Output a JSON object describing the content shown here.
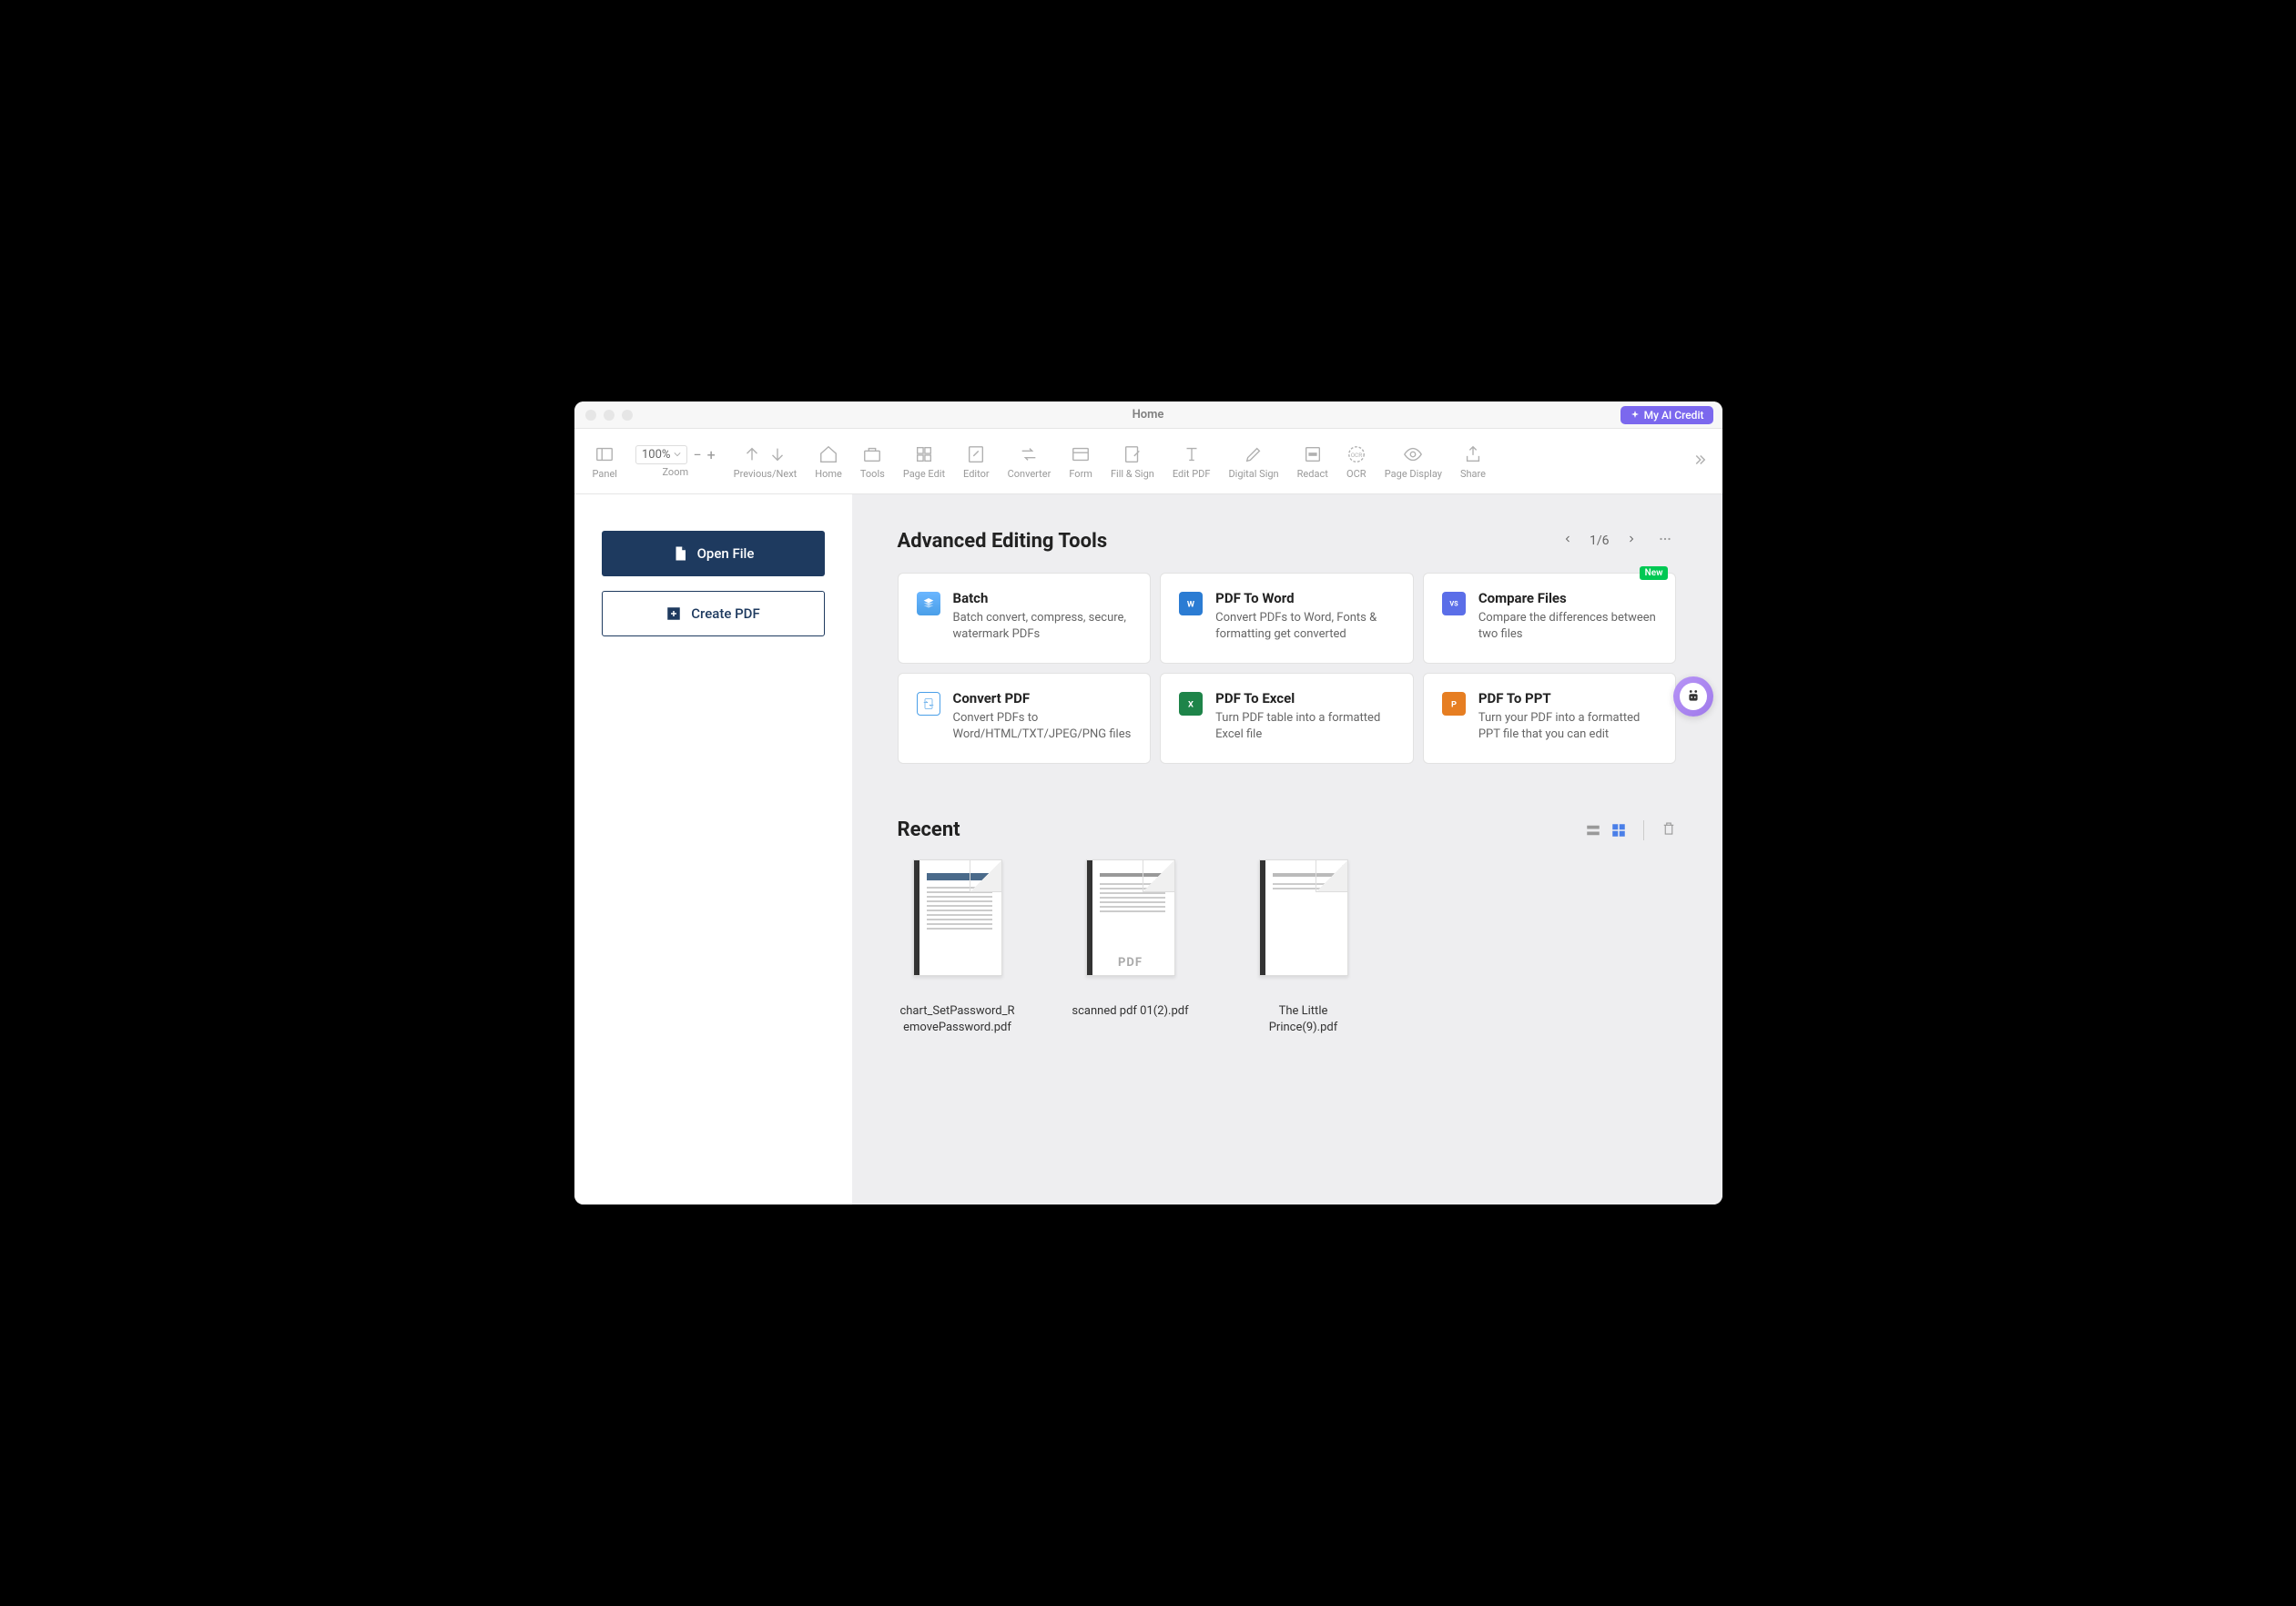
{
  "title": "Home",
  "credit_button": "My AI Credit",
  "toolbar": {
    "panel": "Panel",
    "zoom_label": "Zoom",
    "zoom_value": "100%",
    "items": [
      "Previous/Next",
      "Home",
      "Tools",
      "Page Edit",
      "Editor",
      "Converter",
      "Form",
      "Fill & Sign",
      "Edit PDF",
      "Digital Sign",
      "Redact",
      "OCR",
      "Page Display",
      "Share"
    ]
  },
  "sidebar": {
    "open": "Open File",
    "create": "Create PDF"
  },
  "tools": {
    "heading": "Advanced Editing Tools",
    "page": "1/6",
    "cards": [
      {
        "title": "Batch",
        "desc": "Batch convert, compress, secure, watermark PDFs",
        "icon": "batch",
        "new": false
      },
      {
        "title": "PDF To Word",
        "desc": "Convert PDFs to Word, Fonts & formatting get converted",
        "icon": "word",
        "new": false
      },
      {
        "title": "Compare Files",
        "desc": "Compare the differences between two files",
        "icon": "compare",
        "new": true
      },
      {
        "title": "Convert PDF",
        "desc": "Convert PDFs to Word/HTML/TXT/JPEG/PNG files",
        "icon": "convert",
        "new": false
      },
      {
        "title": "PDF To Excel",
        "desc": "Turn PDF table into a formatted Excel file",
        "icon": "excel",
        "new": false
      },
      {
        "title": "PDF To PPT",
        "desc": "Turn your PDF into a formatted PPT file that you can edit",
        "icon": "ppt",
        "new": false
      }
    ],
    "badge_new": "New"
  },
  "recent": {
    "heading": "Recent",
    "items": [
      {
        "name": "chart_SetPassword_RemovePassword.pdf"
      },
      {
        "name": "scanned pdf 01(2).pdf"
      },
      {
        "name": "The Little Prince(9).pdf"
      }
    ]
  }
}
